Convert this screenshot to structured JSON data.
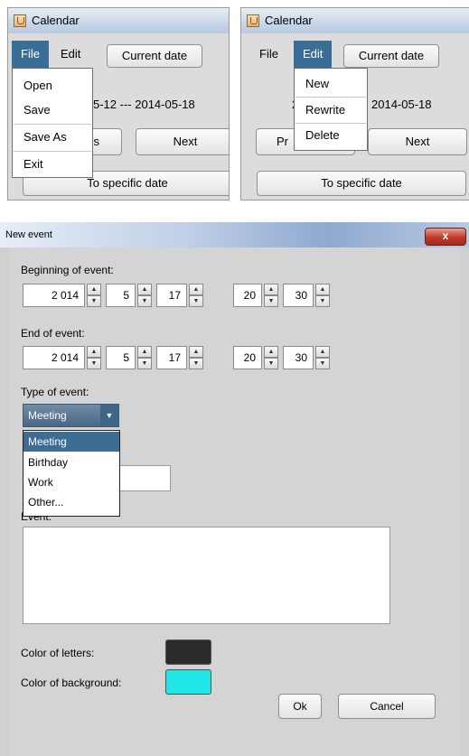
{
  "window1": {
    "title": "Calendar",
    "menu": {
      "file": "File",
      "edit": "Edit"
    },
    "current_date_button": "Current date",
    "date_range": "5-12 --- 2014-05-18",
    "prev_button_partial": "s",
    "next_button": "Next",
    "specific_date_button": "To specific date",
    "file_menu_items": [
      "Open",
      "Save",
      "Save As",
      "Exit"
    ]
  },
  "window2": {
    "title": "Calendar",
    "menu": {
      "file": "File",
      "edit": "Edit"
    },
    "current_date_button": "Current date",
    "date_range_left": "20",
    "date_range_right": "2014-05-18",
    "prev_button_partial": "Pr",
    "next_button": "Next",
    "specific_date_button": "To specific date",
    "edit_menu_items": [
      "New",
      "Rewrite",
      "Delete"
    ]
  },
  "dialog": {
    "title": "New event",
    "close_glyph": "x",
    "beginning_label": "Beginning of event:",
    "beginning": {
      "year": "2 014",
      "month": "5",
      "day": "17",
      "hour": "20",
      "minute": "30"
    },
    "end_label": "End of event:",
    "end": {
      "year": "2 014",
      "month": "5",
      "day": "17",
      "hour": "20",
      "minute": "30"
    },
    "type_label": "Type of event:",
    "type_selected": "Meeting",
    "type_options": [
      "Meeting",
      "Birthday",
      "Work",
      "Other..."
    ],
    "event_label": "Event:",
    "color_letters_label": "Color of letters:",
    "color_background_label": "Color of background:",
    "ok_button": "Ok",
    "cancel_button": "Cancel"
  },
  "colors": {
    "letters": "#2b2b2b",
    "background": "#22e6e6",
    "selection": "#3b6e96"
  }
}
